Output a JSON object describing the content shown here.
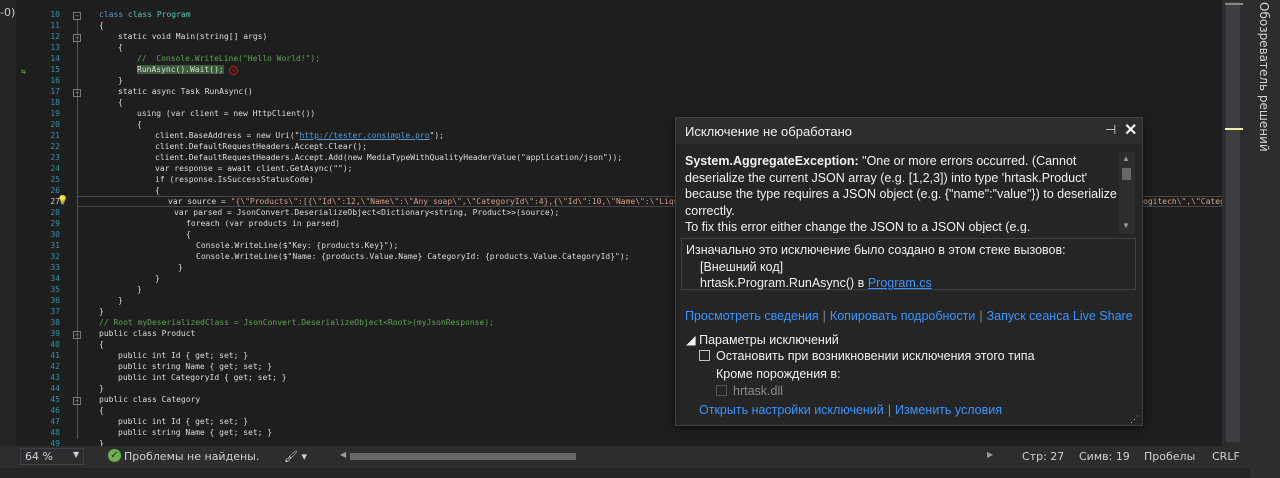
{
  "left_strip": {
    "tab_label": "-0)"
  },
  "right_panel": {
    "label": "Обозреватель решений"
  },
  "editor": {
    "line_numbers": [
      "10",
      "11",
      "12",
      "13",
      "14",
      "15",
      "16",
      "17",
      "18",
      "19",
      "20",
      "21",
      "22",
      "23",
      "24",
      "25",
      "26",
      "27",
      "28",
      "29",
      "30",
      "31",
      "32",
      "33",
      "34",
      "35",
      "36",
      "37",
      "38",
      "39",
      "40",
      "41",
      "42",
      "43",
      "44",
      "45",
      "46",
      "47",
      "48",
      "49"
    ],
    "active_line": "27",
    "code": {
      "l10": "class Program",
      "l11": "{",
      "l12": "static void Main(string[] args)",
      "l13": "{",
      "l14": "//  Console.WriteLine(\"Hello World!\");",
      "l15": "RunAsync().Wait();",
      "l16": "}",
      "l17": "static async Task RunAsync()",
      "l18": "{",
      "l19": "using (var client = new HttpClient())",
      "l20": "{",
      "l21_a": "client.BaseAddress = new Uri(\"",
      "l21_url": "http://tester.consimple.pro",
      "l21_b": "\");",
      "l22": "client.DefaultRequestHeaders.Accept.Clear();",
      "l23": "client.DefaultRequestHeaders.Accept.Add(new MediaTypeWithQualityHeaderValue(\"application/json\"));",
      "l24": "var response = await client.GetAsync(\"\");",
      "l25": "if (response.IsSuccessStatusCode)",
      "l26": "{",
      "l27_a": "var source = ",
      "l27_str": "\"{\\\"Products\\\":[{\\\"Id\\\":12,\\\"Name\\\":\\\"Any soap\\\",\\\"CategoryId\\\":4},{\\\"Id\\\":10,\\\"Name\\\":\\\"Liquid s",
      "l27_tail": "ogitech\\\",\\\"Catego",
      "l28": "var parsed = JsonConvert.DeserializeObject<Dictionary<string, Product>>(source);",
      "l29": "foreach (var products in parsed)",
      "l30": "{",
      "l31": "Console.WriteLine($\"Key: {products.Key}\");",
      "l32": "Console.WriteLine($\"Name: {products.Value.Name} CategoryId: {products.Value.CategoryId}\");",
      "l33": "}",
      "l34": "}",
      "l35": "}",
      "l36": "}",
      "l37": "}",
      "l38": "// Root myDeserializedClass = JsonConvert.DeserializeObject<Root>(myJsonResponse);",
      "l39": "public class Product",
      "l40": "{",
      "l41": "public int Id { get; set; }",
      "l42": "public string Name { get; set; }",
      "l43": "public int CategoryId { get; set; }",
      "l44": "}",
      "l45": "public class Category",
      "l46": "{",
      "l47": "public int Id { get; set; }",
      "l48": "public string Name { get; set; }",
      "l49": "}"
    }
  },
  "exception": {
    "title": "Исключение не обработано",
    "pin_icon": "pin-icon",
    "close_icon": "close-icon",
    "type": "System.AggregateException:",
    "message_line1": " \"One or more errors occurred. (Cannot",
    "message_line2": "deserialize the current JSON array (e.g. [1,2,3]) into type 'hrtask.Product'",
    "message_line3": "because the type requires a JSON object (e.g. {\"name\":\"value\"}) to deserialize",
    "message_line4": "correctly.",
    "message_line5": "To fix this error either change the JSON to a JSON object (e.g.",
    "stack_header": "Изначально это исключение было создано в этом стеке вызовов:",
    "stack_line1": "[Внешний код]",
    "stack_line2": "hrtask.Program.RunAsync() в ",
    "stack_link": "Program.cs",
    "action_view": "Просмотреть сведения",
    "action_copy": "Копировать подробности",
    "action_liveshare": "Запуск сеанса Live Share",
    "settings_header": "Параметры исключений",
    "checkbox_label": "Остановить при возникновении исключения этого типа",
    "except_label": "Кроме порождения в:",
    "dll_label": "hrtask.dll",
    "link_settings": "Открыть настройки исключений",
    "link_conditions": "Изменить условия"
  },
  "status": {
    "zoom": "64 %",
    "problems": "Проблемы не найдены.",
    "line": "Стр: 27",
    "char": "Симв: 19",
    "spaces": "Пробелы",
    "eol": "CRLF"
  },
  "colors": {
    "accent": "#3794ff",
    "error": "#e51400",
    "ok": "#6ab04c"
  }
}
